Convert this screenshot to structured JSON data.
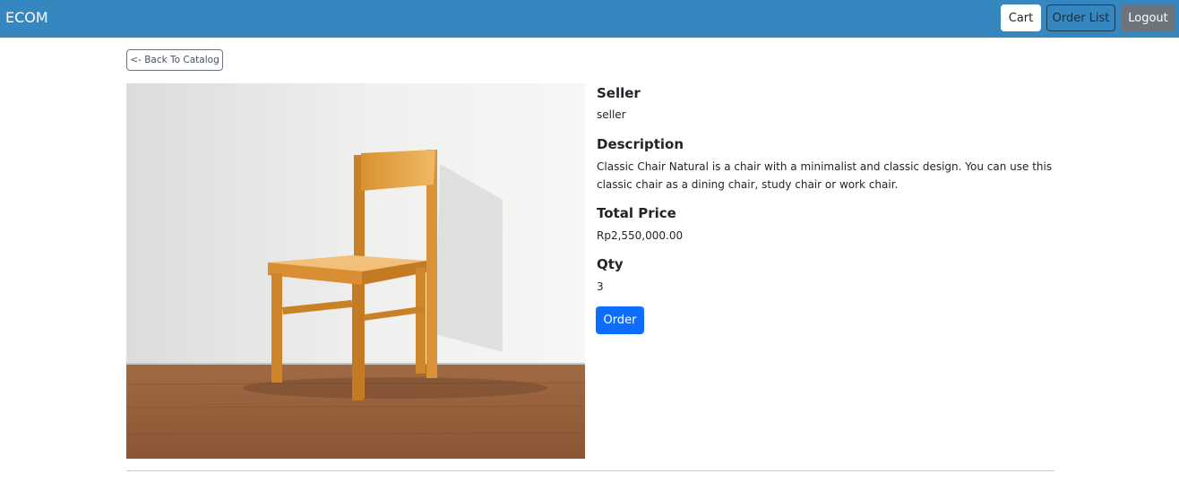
{
  "navbar": {
    "brand": "ECOM",
    "cart_label": "Cart",
    "order_list_label": "Order List",
    "logout_label": "Logout",
    "background_color": "#3686c0"
  },
  "back_button": {
    "label": "<- Back To Catalog"
  },
  "product": {
    "image_alt": "Wooden chair",
    "seller_heading": "Seller",
    "seller": "seller",
    "description_heading": "Description",
    "description": "Classic Chair Natural is a chair with a minimalist and classic design. You can use this classic chair as a dining chair, study chair or work chair.",
    "total_price_heading": "Total Price",
    "total_price": "Rp2,550,000.00",
    "qty_heading": "Qty",
    "qty": "3"
  },
  "order_button": {
    "label": "Order",
    "color": "#0d6efd"
  }
}
